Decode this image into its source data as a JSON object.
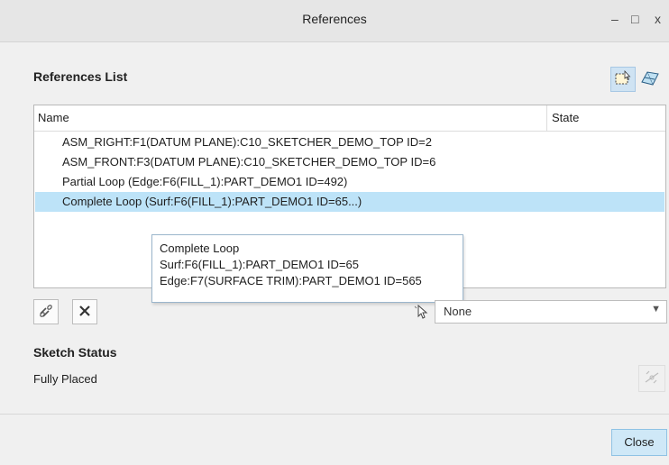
{
  "window": {
    "title": "References",
    "minimize_glyph": "–",
    "maximize_glyph": "□",
    "close_glyph": "x"
  },
  "references": {
    "heading": "References List",
    "columns": {
      "name": "Name",
      "state": "State"
    },
    "rows": [
      {
        "name": "ASM_RIGHT:F1(DATUM PLANE):C10_SKETCHER_DEMO_TOP ID=2",
        "state": ""
      },
      {
        "name": "ASM_FRONT:F3(DATUM PLANE):C10_SKETCHER_DEMO_TOP ID=6",
        "state": ""
      },
      {
        "name": "Partial Loop (Edge:F6(FILL_1):PART_DEMO1 ID=492)",
        "state": ""
      },
      {
        "name": "Complete Loop (Surf:F6(FILL_1):PART_DEMO1 ID=65...)",
        "state": "",
        "selected": true
      }
    ],
    "tooltip": {
      "line1": "Complete Loop",
      "line2": "Surf:F6(FILL_1):PART_DEMO1 ID=65",
      "line3": "Edge:F7(SURFACE TRIM):PART_DEMO1 ID=565"
    },
    "filter": {
      "selected": "None"
    }
  },
  "sketch_status": {
    "heading": "Sketch Status",
    "value": "Fully Placed"
  },
  "footer": {
    "close_label": "Close"
  },
  "icons": {
    "select_tool": "select-reference-icon",
    "xsec_tool": "xsec-reference-icon",
    "replace": "replace-reference-icon",
    "delete": "delete-icon",
    "cursor_filter": "cursor-filter-icon",
    "solve": "solve-icon"
  },
  "colors": {
    "selection": "#bde3f8",
    "accent": "#cfe8f7"
  }
}
